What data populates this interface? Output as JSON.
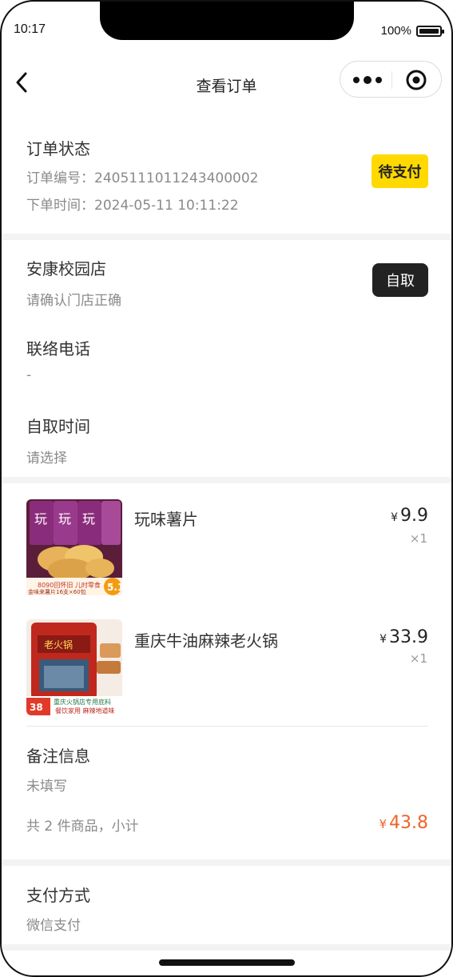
{
  "status_bar": {
    "time": "10:17",
    "battery": "100%"
  },
  "nav": {
    "title": "查看订单"
  },
  "order": {
    "status_label": "订单状态",
    "order_no": "订单编号：2405111011243400002",
    "order_time": "下单时间：2024-05-11 10:11:22",
    "status_badge": "待支付"
  },
  "store": {
    "name": "安康校园店",
    "hint": "请确认门店正确",
    "mode_badge": "自取",
    "phone_label": "联络电话",
    "phone_value": "-",
    "pickup_label": "自取时间",
    "pickup_value": "请选择"
  },
  "items": [
    {
      "name": "玩味薯片",
      "currency": "¥",
      "price": "9.9",
      "qty": "×1"
    },
    {
      "name": "重庆牛油麻辣老火锅",
      "currency": "¥",
      "price": "33.9",
      "qty": "×1"
    }
  ],
  "remark": {
    "label": "备注信息",
    "value": "未填写"
  },
  "summary": {
    "text": "共 2 件商品，小计",
    "currency": "¥",
    "total": "43.8"
  },
  "payment": {
    "label": "支付方式",
    "value": "微信支付"
  },
  "colors": {
    "accent_yellow": "#ffd900",
    "price_orange": "#f0642a",
    "badge_dark": "#222222"
  }
}
